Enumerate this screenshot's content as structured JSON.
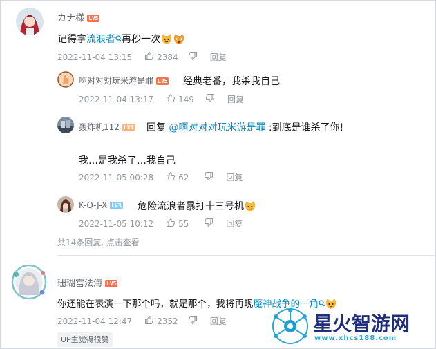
{
  "comments": [
    {
      "user": "カナ様",
      "level": "LV5",
      "text_before": "记得拿",
      "link": "流浪者",
      "text_after": "再秒一次",
      "date": "2022-11-04 13:15",
      "likes": "2384",
      "reply_label": "回复",
      "replies": [
        {
          "user": "啊对对对玩米游是罪",
          "level": "LV5",
          "text": "经典老番，我杀我自己",
          "date": "2022-11-04 13:17",
          "likes": "149",
          "reply_label": "回复"
        },
        {
          "user": "轰炸机112",
          "level": "LV4",
          "reply_prefix": "回复",
          "mention": "@啊对对对玩米游是罪",
          "text": ":到底是谁杀了你!",
          "text_line2": "我…是我杀了…我自己",
          "date": "2022-11-05 00:28",
          "likes": "62",
          "reply_label": "回复"
        },
        {
          "user": "K-Q-J-X",
          "level": "LV3",
          "text": "危险流浪者暴打十三号机",
          "date": "2022-11-05 10:12",
          "likes": "55",
          "reply_label": "回复"
        }
      ],
      "more_text": "共14条回复, 点击查看"
    },
    {
      "user": "珊瑚宫法海",
      "level": "LV5",
      "text_before": "你还能在表演一下那个吗，就是那个，我将再现",
      "link": "魔神战争的一角",
      "date": "2022-11-04 12:47",
      "likes": "2352",
      "reply_label": "回复",
      "tag": "UP主觉得很赞"
    }
  ],
  "watermark": {
    "name": "星火智游网",
    "url": "www.xhcs188.com"
  },
  "icons": {
    "like": "thumbs-up-icon",
    "dislike": "thumbs-down-icon",
    "search": "search-small-icon",
    "emoji": "cat-emoji-icon"
  },
  "colors": {
    "link": "#008ac5",
    "meta": "#9499a0",
    "lv5": "#f6744a",
    "lv4": "#ffb37c",
    "lv3": "#87cefb"
  }
}
